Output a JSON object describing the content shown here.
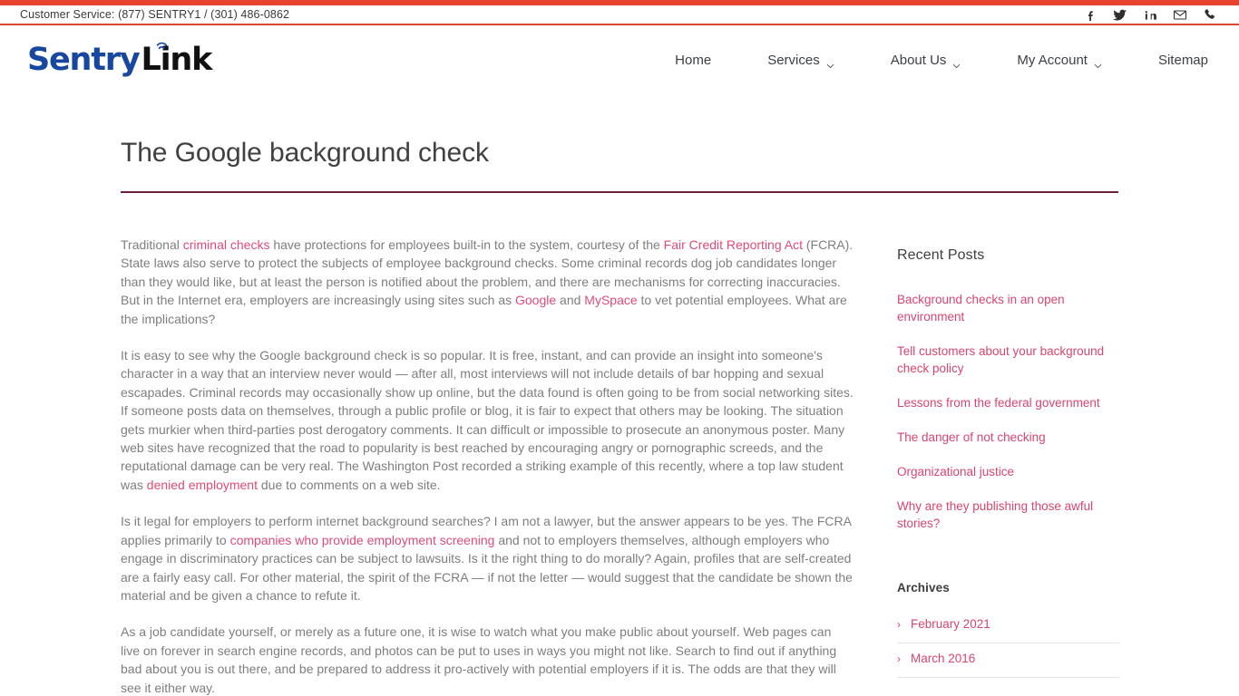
{
  "topbar": {
    "phone_text": "Customer Service: (877) SENTRY1 / (301) 486-0862",
    "accent_color": "#e8432f",
    "social": [
      {
        "name": "facebook-icon",
        "label": "Facebook"
      },
      {
        "name": "twitter-icon",
        "label": "Twitter"
      },
      {
        "name": "linkedin-icon",
        "label": "LinkedIn"
      },
      {
        "name": "email-icon",
        "label": "Email"
      },
      {
        "name": "phone-icon",
        "label": "Phone"
      }
    ]
  },
  "logo": {
    "part1": "Sentry",
    "part2": "Link",
    "part1_color": "#17479e",
    "part2_color": "#111111"
  },
  "nav": {
    "items": [
      {
        "label": "Home",
        "has_caret": false
      },
      {
        "label": "Services",
        "has_caret": true
      },
      {
        "label": "About Us",
        "has_caret": true
      },
      {
        "label": "My Account",
        "has_caret": true
      },
      {
        "label": "Sitemap",
        "has_caret": false
      }
    ]
  },
  "page": {
    "title": "The Google background check",
    "title_rule_color": "#6b1f43",
    "link_color": "#e14b76",
    "body_color": "#7e7e7e"
  },
  "article": {
    "paragraphs": [
      {
        "id": "p1",
        "runs": [
          {
            "t": "Traditional "
          },
          {
            "t": "criminal checks",
            "link": true
          },
          {
            "t": " have protections for employees built-in to the system, courtesy of the "
          },
          {
            "t": "Fair Credit Reporting Act",
            "link": true
          },
          {
            "t": " (FCRA). State laws also serve to protect the subjects of employee background checks. Some criminal records dog job candidates longer than they would like, but at least the person is notified about the problem, and there are mechanisms for correcting inaccuracies. But in the Internet era, employers are increasingly using sites such as "
          },
          {
            "t": "Google",
            "link": true
          },
          {
            "t": " and "
          },
          {
            "t": "MySpace",
            "link": true
          },
          {
            "t": " to vet potential employees. What are the implications?"
          }
        ]
      },
      {
        "id": "p2",
        "runs": [
          {
            "t": "It is easy to see why the Google background check is so popular. It is free, instant, and can provide an insight into someone's character in a way that an interview never would — after all, most interviews will not include details of bar hopping and sexual escapades. Criminal records may occasionally show up online, but the data found is often going to be from social networking sites. If someone posts data on themselves, through a public profile or blog, it is fair to expect that others may be looking. The situation gets murkier when third-parties post derogatory comments. It can difficult or impossible to prosecute an anonymous poster. Many web sites have recognized that the road to popularity is best reached by encouraging angry or pornographic screeds, and the reputational damage can be very real. The Washington Post recorded a striking example of this recently, where a top law student was "
          },
          {
            "t": "denied employment",
            "link": true
          },
          {
            "t": " due to comments on a web site."
          }
        ]
      },
      {
        "id": "p3",
        "runs": [
          {
            "t": "Is it legal for employers to perform internet background searches? I am not a lawyer, but the answer appears to be yes. The FCRA applies primarily to "
          },
          {
            "t": "companies who provide employment screening",
            "link": true
          },
          {
            "t": " and not to employers themselves, although employers who engage in discriminatory practices can be subject to lawsuits. Is it the right thing to do morally? Again, profiles that are self-created are a fairly easy call. For other material, the spirit of the FCRA — if not the letter — would suggest that the candidate be shown the material and be given a chance to refute it."
          }
        ]
      },
      {
        "id": "p4",
        "runs": [
          {
            "t": "As a job candidate yourself, or merely as a future one, it is wise to watch what you make public about yourself. Web pages can live on forever in search engine records, and photos can be put to uses in ways you might not like. Search to find out if anything bad about you is out there, and be prepared to address it pro-actively with potential employers if it is. The odds are that they will see it either way."
          }
        ]
      }
    ]
  },
  "sidebar": {
    "recent_posts": {
      "title": "Recent Posts",
      "items": [
        {
          "label": "Background checks in an open environment"
        },
        {
          "label": "Tell customers about your background check policy"
        },
        {
          "label": "Lessons from the federal government"
        },
        {
          "label": "The danger of not checking"
        },
        {
          "label": "Organizational justice"
        },
        {
          "label": "Why are they publishing those awful stories?"
        }
      ]
    },
    "archives": {
      "title": "Archives",
      "items": [
        {
          "label": "February 2021",
          "marker": "›"
        },
        {
          "label": "March 2016",
          "marker": "›"
        }
      ]
    }
  }
}
